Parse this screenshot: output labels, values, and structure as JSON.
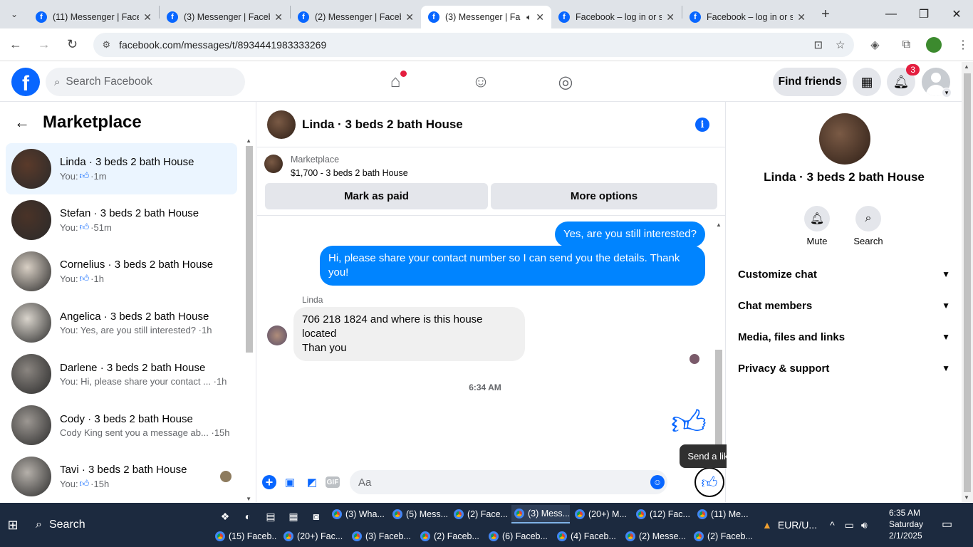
{
  "browser": {
    "tabs": [
      {
        "title": "(11) Messenger | Face",
        "active": false
      },
      {
        "title": "(3) Messenger | Faceb",
        "active": false
      },
      {
        "title": "(2) Messenger | Faceb",
        "active": false
      },
      {
        "title": "(3) Messenger | Fa",
        "active": true
      },
      {
        "title": "Facebook – log in or s",
        "active": false
      },
      {
        "title": "Facebook – log in or s",
        "active": false
      }
    ],
    "url": "facebook.com/messages/t/8934441983333269"
  },
  "fb_header": {
    "search_placeholder": "Search Facebook",
    "find_friends": "Find friends",
    "notifications_count": "3"
  },
  "sidebar": {
    "title": "Marketplace",
    "conversations": [
      {
        "name": "Linda · 3 beds 2 bath House",
        "prefix": "You:",
        "like": true,
        "time": "1m",
        "active": true,
        "thumb": "#5a3a2a"
      },
      {
        "name": "Stefan · 3 beds 2 bath House",
        "prefix": "You:",
        "like": true,
        "time": "51m",
        "active": false,
        "thumb": "#4a3328"
      },
      {
        "name": "Cornelius · 3 beds 2 bath House",
        "prefix": "You:",
        "like": true,
        "time": "1h",
        "active": false,
        "thumb": "#d8cfc4"
      },
      {
        "name": "Angelica · 3 beds 2 bath House",
        "prefix": "You: Yes, are you still interested?",
        "like": false,
        "time": "1h",
        "active": false,
        "thumb": "#d9d4cc"
      },
      {
        "name": "Darlene · 3 beds 2 bath House",
        "prefix": "You: Hi, please share your contact ...",
        "like": false,
        "time": "1h",
        "active": false,
        "thumb": "#8a8580"
      },
      {
        "name": "Cody · 3 beds 2 bath House",
        "prefix": "Cody King sent you a message ab...",
        "like": false,
        "time": "15h",
        "active": false,
        "thumb": "#9c9792"
      },
      {
        "name": "Tavi · 3 beds 2 bath House",
        "prefix": "You:",
        "like": true,
        "time": "15h",
        "active": false,
        "thumb": "#b5b0aa"
      }
    ]
  },
  "chat": {
    "title": "Linda · 3 beds 2 bath House",
    "listing_source": "Marketplace",
    "listing_price": "$1,700 - 3 beds 2 bath House",
    "mark_paid": "Mark as paid",
    "more_options": "More options",
    "msg_out_1": "Yes, are you still interested?",
    "msg_out_2": "Hi, please share your contact number so I can send you the details. Thank you!",
    "sender_name": "Linda",
    "msg_in_1": "706 218 1824 and where is this house located",
    "msg_in_2": "Than you",
    "timestamp": "6:34 AM",
    "composer_placeholder": "Aa",
    "tooltip": "Send a like",
    "gif_label": "GIF"
  },
  "info_panel": {
    "name": "Linda · 3 beds 2 bath House",
    "mute": "Mute",
    "search": "Search",
    "sections": [
      "Customize chat",
      "Chat members",
      "Media, files and links",
      "Privacy & support"
    ]
  },
  "taskbar": {
    "search": "Search",
    "row1": [
      "(3) Wha...",
      "(5) Mess...",
      "(2) Face...",
      "(3) Mess...",
      "(20+) M...",
      "(12) Fac...",
      "(11) Me..."
    ],
    "row2": [
      "(15) Faceb...",
      "(20+) Fac...",
      "(3) Faceb...",
      "(2) Faceb...",
      "(6) Faceb...",
      "(4) Faceb...",
      "(2) Messe...",
      "(2) Faceb..."
    ],
    "currency": "EUR/U...",
    "time": "6:35 AM",
    "day": "Saturday",
    "date": "2/1/2025"
  },
  "icons": {
    "home": "home-icon",
    "friends": "friends-icon",
    "groups": "groups-icon",
    "apps": "grid-icon",
    "bell": "bell-icon",
    "info": "info-icon",
    "like": "thumbs-up-icon",
    "search": "search-icon"
  }
}
